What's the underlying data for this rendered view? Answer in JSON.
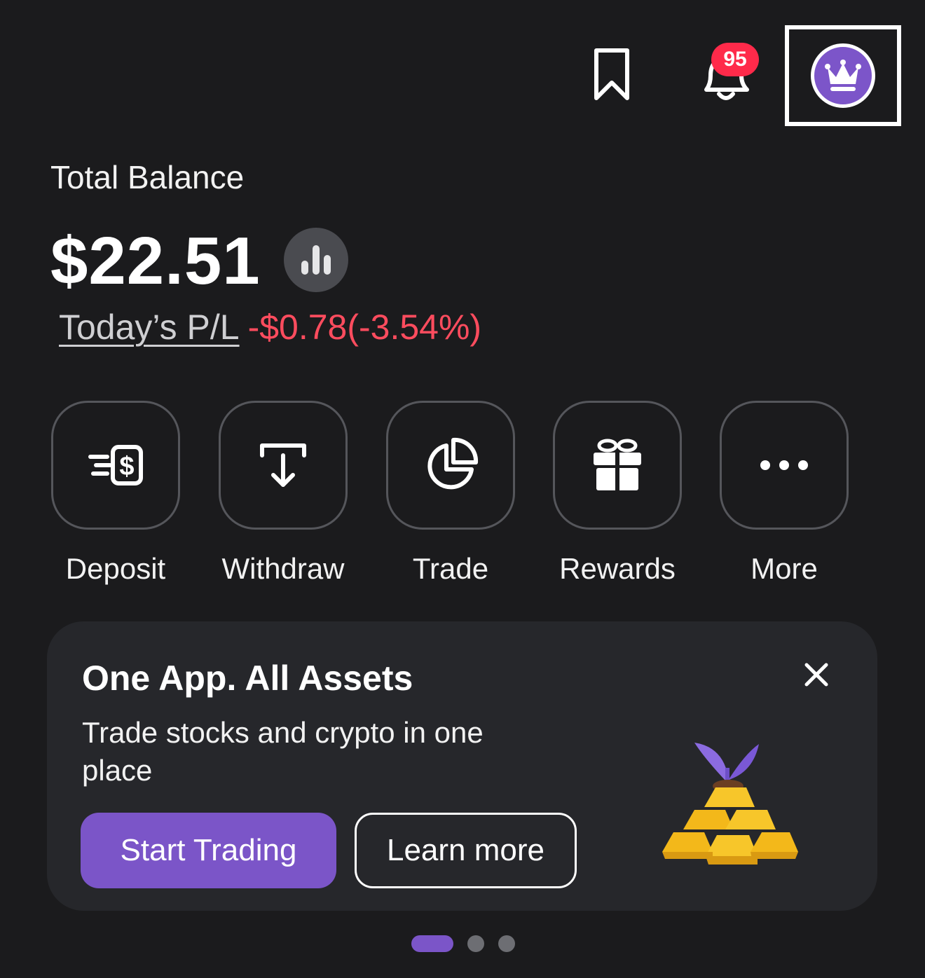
{
  "header": {
    "notification_count": "95",
    "icons": [
      "bookmark-icon",
      "bell-icon",
      "crown-avatar-icon"
    ]
  },
  "balance": {
    "label": "Total Balance",
    "value": "$22.51",
    "pl_label": "Today’s P/L",
    "pl_value": "-$0.78(-3.54%)",
    "pl_color": "#ff4c5e"
  },
  "actions": [
    {
      "label": "Deposit",
      "icon": "deposit-icon"
    },
    {
      "label": "Withdraw",
      "icon": "withdraw-icon"
    },
    {
      "label": "Trade",
      "icon": "pie-chart-icon"
    },
    {
      "label": "Rewards",
      "icon": "gift-icon"
    },
    {
      "label": "More",
      "icon": "more-dots-icon"
    }
  ],
  "promo": {
    "title": "One App. All Assets",
    "text": "Trade stocks and crypto in one place",
    "primary_button": "Start Trading",
    "secondary_button": "Learn more"
  },
  "pager": {
    "pages": 3,
    "active": 1
  },
  "colors": {
    "background": "#1b1b1d",
    "card": "#26272b",
    "accent": "#7b55c8",
    "badge": "#ff2a4a"
  }
}
